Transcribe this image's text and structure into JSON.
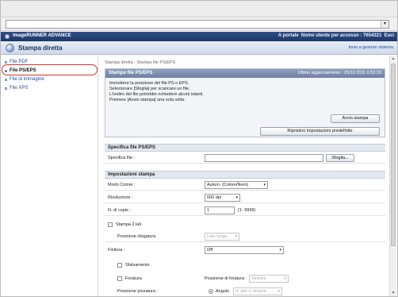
{
  "brand": {
    "product": "imageRUNNER ADVANCE",
    "portal_link": "A portale",
    "user_info": "Nome utente per accesso : 7654321",
    "exit_link": "Esci"
  },
  "header": {
    "title": "Stampa diretta",
    "send_to_admin": "Invio a gestore sistema"
  },
  "sidebar": {
    "items": [
      {
        "label": "File PDF"
      },
      {
        "label": "File PS/EPS"
      },
      {
        "label": "File di immagine"
      },
      {
        "label": "File XPS"
      }
    ]
  },
  "main": {
    "breadcrumb": "Stampa diretta : Stampa file PS/EPS",
    "panel": {
      "title": "Stampa file PS/EPS",
      "last_update": "Ultimo aggiornamento : 20/10 2011 6.53.16",
      "messages": [
        "Immettere la posizione del file PS o EPS.",
        "Selezionare [Sfoglia] per scaricare un file.",
        "L'inoltro del file potrebbe richiedere alcuni istanti.",
        "Premere [Avvio stampa] una sola volta."
      ],
      "start_button": "Avvio stampa",
      "reset_button": "Ripristino impostazioni predefinite"
    },
    "file_section": {
      "title": "Specifica file PS/EPS",
      "file_label": "Specifica file :",
      "browse_button": "Sfoglia..."
    },
    "settings": {
      "title": "Impostazioni stampa",
      "color_mode_label": "Modo Colore :",
      "color_mode_value": "Autom. (Colore/Nero)",
      "resolution_label": "Risoluzione :",
      "resolution_value": "600 dpi",
      "copies_label": "N. di copie :",
      "copies_value": "1",
      "copies_range": "(1- 9999)",
      "duplex_label": "Stampa 2 lati",
      "binding_label": "Posizione rilegatura",
      "binding_value": "Lato lungo",
      "finishing_label": "Finitura :",
      "finishing_value": "Off",
      "offset_label": "Sfalsamento",
      "punch_label": "Foratura",
      "punch_pos_label": "Posizione di foratura",
      "punch_pos_value": "Sinistra",
      "staple_label": "Posizione pinzatura :",
      "staple_radio_label": "Angolo",
      "staple_value": "In alto a sinistra"
    }
  }
}
